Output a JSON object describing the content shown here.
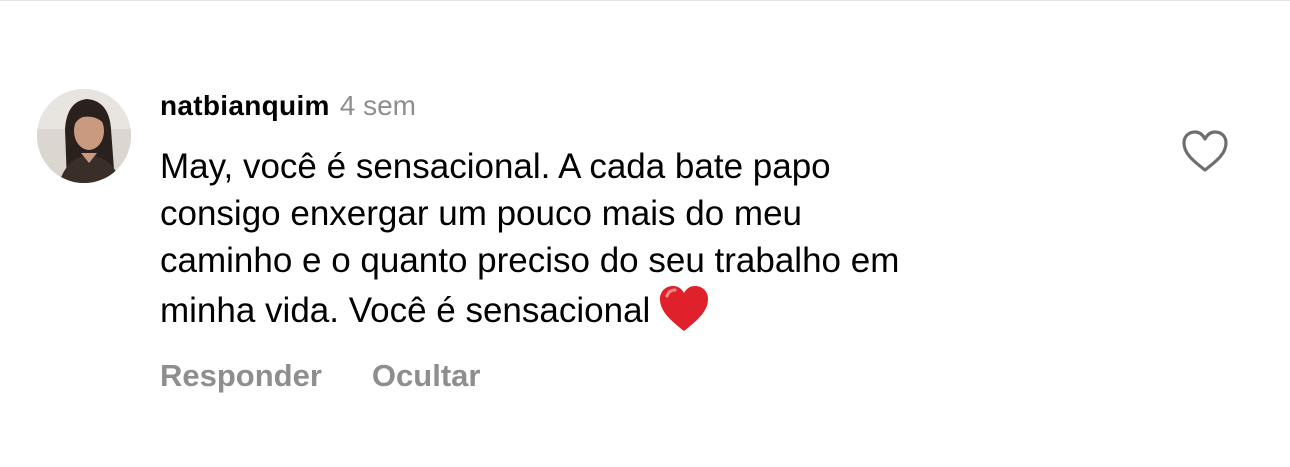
{
  "comment": {
    "username": "natbianquim",
    "timestamp": "4 sem",
    "text_lines": [
      "May, você é sensacional. A cada bate papo",
      "consigo enxergar um pouco mais do meu",
      "caminho e o quanto preciso do seu trabalho em",
      "minha vida. Você é sensacional"
    ],
    "emoji": "heart-emoji-red",
    "like_icon": "heart-outline-icon"
  },
  "actions": {
    "reply_label": "Responder",
    "hide_label": "Ocultar"
  },
  "colors": {
    "secondary_text": "#8e8e8e",
    "primary_text": "#000000",
    "emoji_heart": "#e0202b"
  }
}
